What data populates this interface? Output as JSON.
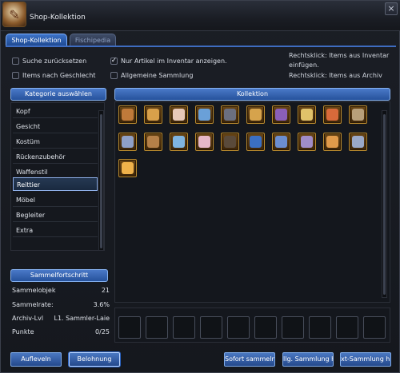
{
  "window": {
    "title": "Shop-Kollektion",
    "close_glyph": "×",
    "logo_glyph": "✎"
  },
  "tabs": [
    {
      "label": "Shop-Kollektion",
      "active": true
    },
    {
      "label": "Fischipedia",
      "active": false
    }
  ],
  "options": {
    "reset_search": {
      "label": "Suche zurücksetzen",
      "checked": false
    },
    "only_inventory": {
      "label": "Nur Artikel im Inventar anzeigen.",
      "checked": true
    },
    "by_gender": {
      "label": "Items nach Geschlecht",
      "checked": false
    },
    "general_collection": {
      "label": "Allgemeine Sammlung",
      "checked": false
    }
  },
  "hints": {
    "line1": "Rechtsklick: Items aus Inventar",
    "line2": "einfügen.",
    "line3": "Rechtsklick: Items aus Archiv"
  },
  "category": {
    "header": "Kategorie auswählen",
    "items": [
      "Kopf",
      "Gesicht",
      "Kostüm",
      "Rückenzubehör",
      "Waffenstil",
      "Reittier",
      "Möbel",
      "Begleiter",
      "Extra"
    ],
    "selected": "Reittier"
  },
  "collection": {
    "header": "Kollektion",
    "item_count": 21
  },
  "progress": {
    "header": "Sammelfortschritt",
    "rows": [
      {
        "label": "Sammelobjek",
        "value": "21"
      },
      {
        "label": "Sammelrate:",
        "value": "3.6%"
      },
      {
        "label": "Archiv-Lvl",
        "value": "L1. Sammler-Laie"
      },
      {
        "label": "Punkte",
        "value": "0/25"
      }
    ]
  },
  "buttons": {
    "level_up": "Aufleveln",
    "reward": "Belohnung",
    "collect_now": "Sofort sammeln",
    "general_collection": "llg. Sammlung hi",
    "text_collection": "xt-Sammlung hi"
  },
  "colors": {
    "accent": "#3c73c9",
    "item_border": "#b98a2e"
  }
}
